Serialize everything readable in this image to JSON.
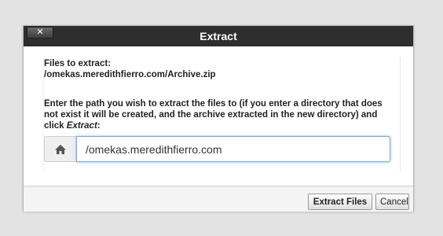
{
  "dialog": {
    "title": "Extract",
    "close_label": "✕"
  },
  "files": {
    "label": "Files to extract:",
    "path": "/omekas.meredithfierro.com/Archive.zip"
  },
  "instructions": {
    "text_before": "Enter the path you wish to extract the files to (if you enter a directory that does not exist it will be created, and the archive extracted in the new directory) and click ",
    "emphasis": "Extract",
    "text_after": ":"
  },
  "destination": {
    "icon": "home-icon",
    "value": "/omekas.meredithfierro.com"
  },
  "buttons": {
    "extract": "Extract Files",
    "cancel": "Cancel"
  }
}
